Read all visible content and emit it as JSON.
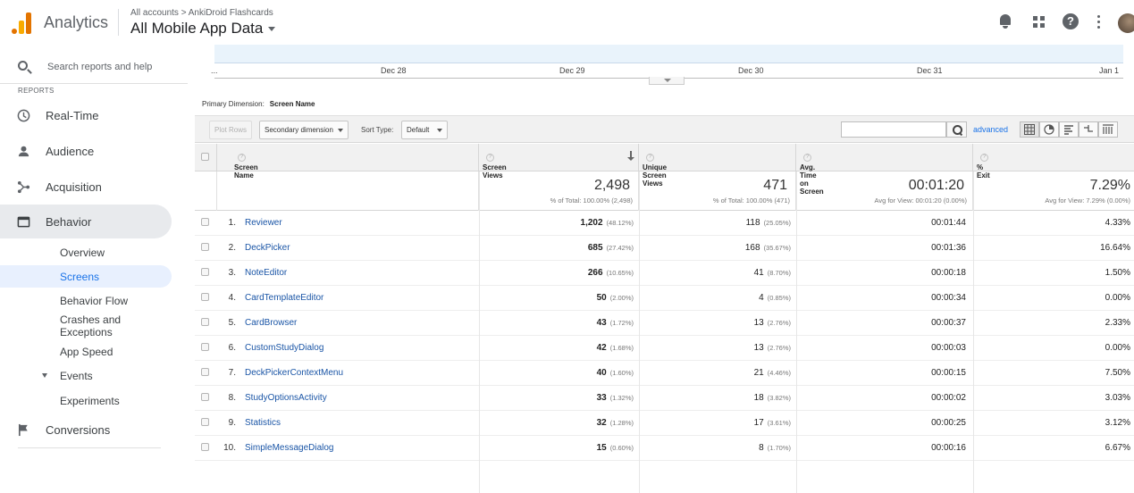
{
  "header": {
    "app_name": "Analytics",
    "breadcrumb": "All accounts > AnkiDroid Flashcards",
    "view_title": "All Mobile App Data",
    "help_glyph": "?"
  },
  "sidebar": {
    "search_placeholder": "Search reports and help",
    "reports_label": "REPORTS",
    "items": [
      {
        "label": "Real-Time",
        "icon": "clock-icon"
      },
      {
        "label": "Audience",
        "icon": "person-icon"
      },
      {
        "label": "Acquisition",
        "icon": "acquisition-icon"
      },
      {
        "label": "Behavior",
        "icon": "behavior-icon"
      },
      {
        "label": "Conversions",
        "icon": "flag-icon"
      }
    ],
    "behavior_sub": [
      "Overview",
      "Screens",
      "Behavior Flow",
      "Crashes and Exceptions",
      "App Speed",
      "Events",
      "Experiments"
    ]
  },
  "timeline": {
    "start_marker": "...",
    "dates": [
      "Dec 28",
      "Dec 29",
      "Dec 30",
      "Dec 31",
      "Jan 1"
    ]
  },
  "primary_dimension": {
    "label": "Primary Dimension:",
    "value": "Screen Name"
  },
  "toolbar": {
    "plot_rows": "Plot Rows",
    "secondary_dimension": "Secondary dimension",
    "sort_type_label": "Sort Type:",
    "sort_type_value": "Default",
    "advanced": "advanced",
    "search_value": ""
  },
  "table": {
    "columns": [
      "Screen Name",
      "Screen Views",
      "Unique Screen Views",
      "Avg. Time on Screen",
      "% Exit"
    ],
    "totals": {
      "screen_views": "2,498",
      "screen_views_sub": "% of Total: 100.00% (2,498)",
      "unique_views": "471",
      "unique_views_sub": "% of Total: 100.00% (471)",
      "avg_time": "00:01:20",
      "avg_time_sub": "Avg for View: 00:01:20 (0.00%)",
      "exit": "7.29%",
      "exit_sub": "Avg for View: 7.29% (0.00%)"
    },
    "rows": [
      {
        "num": "1.",
        "name": "Reviewer",
        "views": "1,202",
        "views_pct": "(48.12%)",
        "unique": "118",
        "unique_pct": "(25.05%)",
        "time": "00:01:44",
        "exit": "4.33%"
      },
      {
        "num": "2.",
        "name": "DeckPicker",
        "views": "685",
        "views_pct": "(27.42%)",
        "unique": "168",
        "unique_pct": "(35.67%)",
        "time": "00:01:36",
        "exit": "16.64%"
      },
      {
        "num": "3.",
        "name": "NoteEditor",
        "views": "266",
        "views_pct": "(10.65%)",
        "unique": "41",
        "unique_pct": "(8.70%)",
        "time": "00:00:18",
        "exit": "1.50%"
      },
      {
        "num": "4.",
        "name": "CardTemplateEditor",
        "views": "50",
        "views_pct": "(2.00%)",
        "unique": "4",
        "unique_pct": "(0.85%)",
        "time": "00:00:34",
        "exit": "0.00%"
      },
      {
        "num": "5.",
        "name": "CardBrowser",
        "views": "43",
        "views_pct": "(1.72%)",
        "unique": "13",
        "unique_pct": "(2.76%)",
        "time": "00:00:37",
        "exit": "2.33%"
      },
      {
        "num": "6.",
        "name": "CustomStudyDialog",
        "views": "42",
        "views_pct": "(1.68%)",
        "unique": "13",
        "unique_pct": "(2.76%)",
        "time": "00:00:03",
        "exit": "0.00%"
      },
      {
        "num": "7.",
        "name": "DeckPickerContextMenu",
        "views": "40",
        "views_pct": "(1.60%)",
        "unique": "21",
        "unique_pct": "(4.46%)",
        "time": "00:00:15",
        "exit": "7.50%"
      },
      {
        "num": "8.",
        "name": "StudyOptionsActivity",
        "views": "33",
        "views_pct": "(1.32%)",
        "unique": "18",
        "unique_pct": "(3.82%)",
        "time": "00:00:02",
        "exit": "3.03%"
      },
      {
        "num": "9.",
        "name": "Statistics",
        "views": "32",
        "views_pct": "(1.28%)",
        "unique": "17",
        "unique_pct": "(3.61%)",
        "time": "00:00:25",
        "exit": "3.12%"
      },
      {
        "num": "10.",
        "name": "SimpleMessageDialog",
        "views": "15",
        "views_pct": "(0.60%)",
        "unique": "8",
        "unique_pct": "(1.70%)",
        "time": "00:00:16",
        "exit": "6.67%"
      }
    ]
  },
  "colors": {
    "accent": "#1a73e8",
    "link": "#1a55a6",
    "logo_orange": "#e37400",
    "logo_yellow": "#f9ab00"
  }
}
